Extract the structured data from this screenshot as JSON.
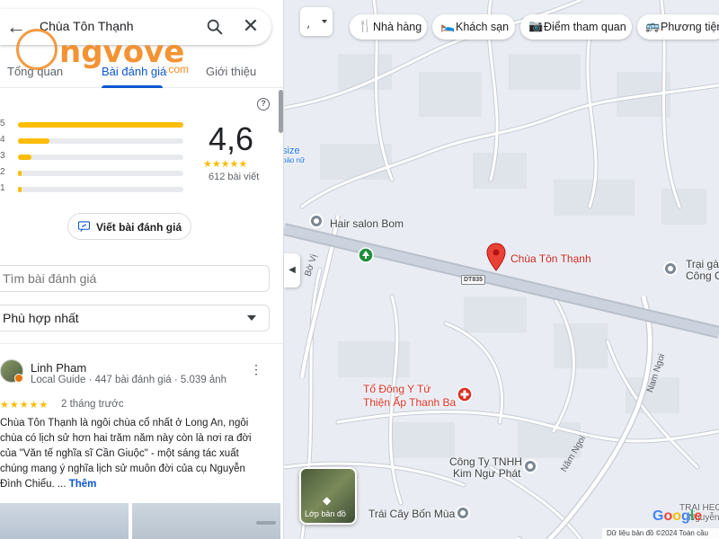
{
  "search": {
    "query": "Chùa Tôn Thạnh"
  },
  "watermark": {
    "brand": "ngvove",
    "domain": ".com"
  },
  "tabs": [
    {
      "label": "Tổng quan"
    },
    {
      "label": "Bài đánh giá"
    },
    {
      "label": "Giới thiệu"
    }
  ],
  "rating": {
    "value": "4,6",
    "stars": "★★★★★",
    "count_label": "612 bài viết",
    "distribution": [
      {
        "label": "5",
        "fraction": 1.0
      },
      {
        "label": "4",
        "fraction": 0.19
      },
      {
        "label": "3",
        "fraction": 0.08
      },
      {
        "label": "2",
        "fraction": 0.02
      },
      {
        "label": "1",
        "fraction": 0.02
      }
    ]
  },
  "actions": {
    "write_review": "Viết bài đánh giá"
  },
  "review_search": {
    "placeholder": "Tìm bài đánh giá"
  },
  "sort": {
    "selected": "Phù hợp nhất"
  },
  "review": {
    "author": "Linh Pham",
    "meta": "Local Guide · 447 bài đánh giá · 5.039 ảnh",
    "stars": "★★★★★",
    "date": "2 tháng trước",
    "text": "Chùa Tôn Thạnh là ngôi chùa cổ nhất ở Long An, ngôi chùa có lịch sử hơn hai trăm năm này còn là nơi ra đời của \"Văn tế nghĩa sĩ Cần Giuộc\" - một sáng tác xuất chúng mang ý nghĩa lịch sử muôn đời của cụ Nguyễn Đình Chiểu. ...",
    "more": "Thêm"
  },
  "map": {
    "chips": [
      {
        "label": "Nhà hàng",
        "icon": "fork-knife-icon"
      },
      {
        "label": "Khách sạn",
        "icon": "bed-icon"
      },
      {
        "label": "Điểm tham quan",
        "icon": "camera-icon"
      },
      {
        "label": "Phương tiện",
        "icon": "bus-icon"
      }
    ],
    "pin_label": "Chùa Tôn Thạnh",
    "places": {
      "hair_salon": "Hair salon Bom",
      "to_dong_y": "Tổ Đông Y Tứ\nThiện Ấp Thanh Ba",
      "cong_ty": "Công Ty TNHH\nKim Ngư Phát",
      "trai_cay": "Trái Cây Bốn Mùa",
      "trai_ga": "Trại gà\nCông C",
      "trai_heo": "TRẠI HEO\nNguyễn",
      "size": "size",
      "bao_nu": "bảo nữ"
    },
    "roads": {
      "dt835": "DT835",
      "bo_vi": "Bờ Vị",
      "nam_ngoi_1": "Nam Ngoi",
      "nam_ngoi_2": "Năm Ngoi"
    },
    "layers_label": "Lớp bản đồ",
    "google": "Google",
    "footer": "Dữ liệu bản đồ ©2024    Toàn cầu"
  }
}
